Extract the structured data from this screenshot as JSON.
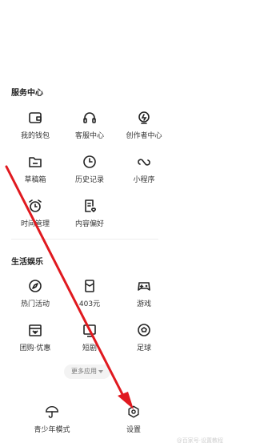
{
  "sections": {
    "services": {
      "title": "服务中心",
      "items": [
        {
          "label": "我的钱包",
          "icon": "wallet-icon"
        },
        {
          "label": "客服中心",
          "icon": "headset-icon"
        },
        {
          "label": "创作者中心",
          "icon": "lightbulb-icon"
        },
        {
          "label": "草稿箱",
          "icon": "folder-icon"
        },
        {
          "label": "历史记录",
          "icon": "clock-icon"
        },
        {
          "label": "小程序",
          "icon": "infinity-icon"
        },
        {
          "label": "时间管理",
          "icon": "alarm-icon"
        },
        {
          "label": "内容偏好",
          "icon": "preference-icon"
        }
      ]
    },
    "life": {
      "title": "生活娱乐",
      "items": [
        {
          "label": "热门活动",
          "icon": "compass-icon"
        },
        {
          "label": "403元",
          "icon": "red-envelope-icon"
        },
        {
          "label": "游戏",
          "icon": "gamepad-icon"
        },
        {
          "label": "团购·优惠",
          "icon": "coupon-icon"
        },
        {
          "label": "短剧",
          "icon": "tv-icon"
        },
        {
          "label": "足球",
          "icon": "football-icon"
        }
      ]
    }
  },
  "more_apps": {
    "label": "更多应用"
  },
  "bottom": {
    "teen_mode": {
      "label": "青少年模式",
      "icon": "umbrella-icon"
    },
    "settings": {
      "label": "设置",
      "icon": "hexagon-gear-icon"
    }
  },
  "watermark": "@百家号·设置教程",
  "colors": {
    "arrow": "#e0191f",
    "text": "#222222",
    "icon_stroke": "#222222"
  }
}
